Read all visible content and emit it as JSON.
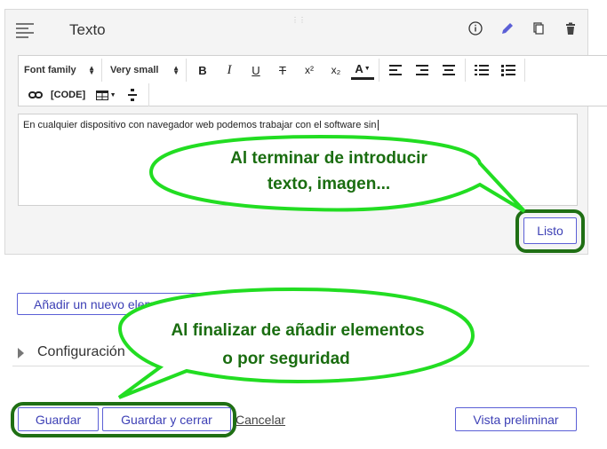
{
  "panel": {
    "title": "Texto",
    "icons": [
      "info-icon",
      "pencil-icon",
      "copy-icon",
      "trash-icon"
    ],
    "accent_color": "#5b5fd6"
  },
  "toolbar": {
    "font_family": "Font family",
    "font_size": "Very small",
    "buttons": [
      "B",
      "I",
      "U",
      "T",
      "x²",
      "x₂",
      "A"
    ],
    "code_label": "[CODE]"
  },
  "editor": {
    "content": "En cualquier dispositivo con navegador web podemos trabajar con el software sin"
  },
  "buttons": {
    "listo": "Listo",
    "add_element": "Añadir un nuevo elemento",
    "guardar": "Guardar",
    "guardar_cerrar": "Guardar y cerrar",
    "cancelar": "Cancelar",
    "preview": "Vista preliminar"
  },
  "section": {
    "config_label": "Configuración"
  },
  "callouts": {
    "top_line1": "Al terminar de introducir",
    "top_line2": "texto, imagen...",
    "bottom_line1": "Al finalizar de añadir elementos",
    "bottom_line2": "o por seguridad",
    "highlight_color": "#1f6f14",
    "bubble_border": "#22dd22"
  }
}
